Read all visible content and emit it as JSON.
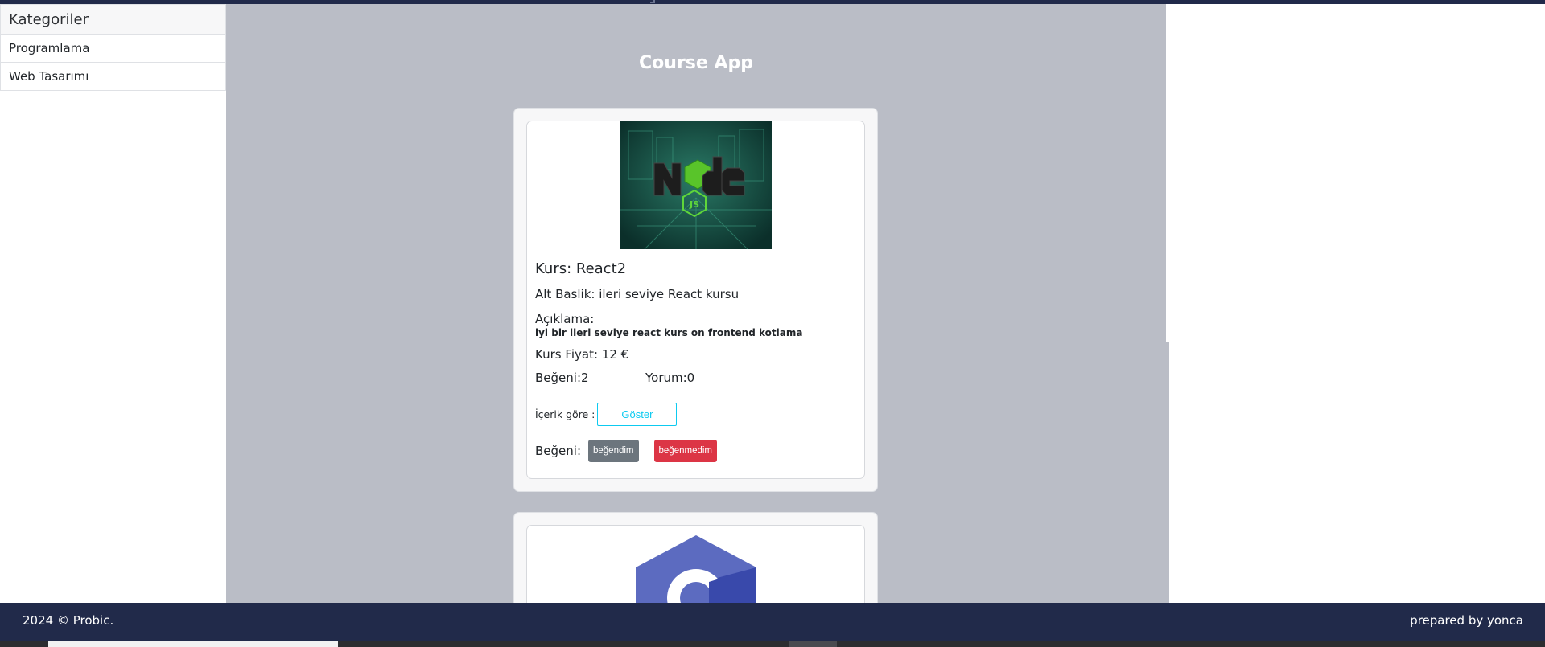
{
  "sidebar": {
    "header": "Kategoriler",
    "items": [
      {
        "label": "Programlama"
      },
      {
        "label": "Web Tasarımı"
      }
    ]
  },
  "main": {
    "title": "Course App",
    "courses": [
      {
        "image_icon": "nodejs-logo-image",
        "name": "Kurs: React2",
        "subtitle": "Alt Baslik: ileri seviye React kursu",
        "description_label": "Açıklama:",
        "description": "iyi bir ileri seviye react kurs on frontend kotlama",
        "price": "Kurs Fiyat: 12 €",
        "likes": "Beğeni:2",
        "comments": "Yorum:0",
        "content_label": "İçerik göre :",
        "show_button": "Göster",
        "like_label": "Beğeni:",
        "like_button": "beğendim",
        "dislike_button": "beğenmedim"
      },
      {
        "image_icon": "csharp-logo-image"
      }
    ]
  },
  "footer": {
    "left": "2024 © Probic.",
    "right": "prepared by yonca"
  },
  "colors": {
    "navy": "#212a4a",
    "main_bg": "#babdc6",
    "info": "#0dcaf0",
    "secondary": "#6c757d",
    "danger": "#dc3545"
  }
}
